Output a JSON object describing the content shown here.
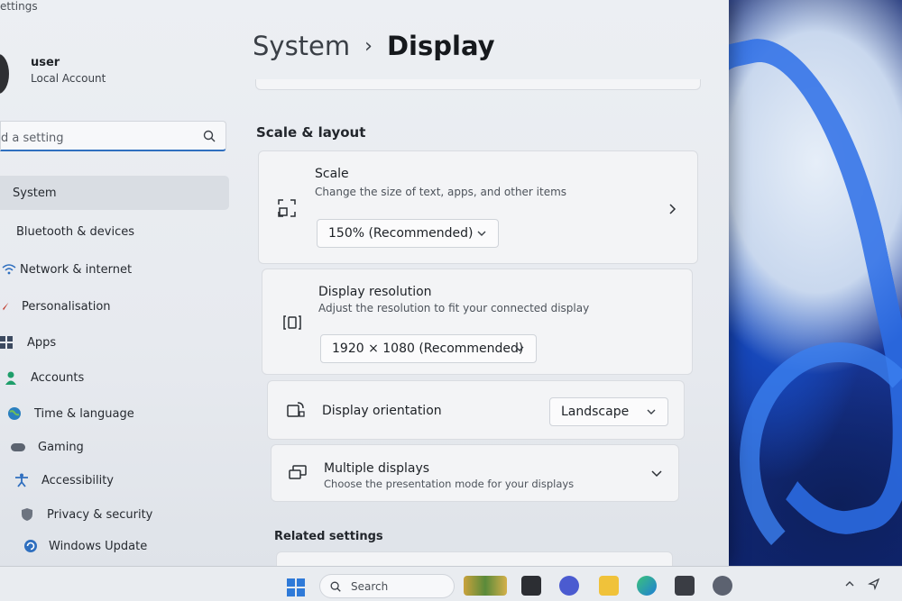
{
  "app": {
    "title": "ettings"
  },
  "profile": {
    "name": "user",
    "type": "Local Account"
  },
  "search": {
    "placeholder": "d a setting"
  },
  "sidebar": {
    "items": [
      {
        "label": "System",
        "icon": "monitor-icon",
        "active": true
      },
      {
        "label": "Bluetooth & devices",
        "icon": "bluetooth-icon"
      },
      {
        "label": "Network & internet",
        "icon": "wifi-icon"
      },
      {
        "label": "Personalisation",
        "icon": "brush-icon"
      },
      {
        "label": "Apps",
        "icon": "apps-icon"
      },
      {
        "label": "Accounts",
        "icon": "person-icon"
      },
      {
        "label": "Time & language",
        "icon": "globe-icon"
      },
      {
        "label": "Gaming",
        "icon": "gamepad-icon"
      },
      {
        "label": "Accessibility",
        "icon": "accessibility-icon"
      },
      {
        "label": "Privacy & security",
        "icon": "shield-icon"
      },
      {
        "label": "Windows Update",
        "icon": "update-icon"
      }
    ]
  },
  "header": {
    "parent": "System",
    "separator": "›",
    "current": "Display"
  },
  "scale_layout": {
    "title": "Scale & layout",
    "scale": {
      "title": "Scale",
      "description": "Change the size of text, apps, and other items",
      "value": "150% (Recommended)"
    },
    "resolution": {
      "title": "Display resolution",
      "description": "Adjust the resolution to fit your connected display",
      "value": "1920 × 1080 (Recommended)"
    },
    "orientation": {
      "title": "Display orientation",
      "value": "Landscape"
    },
    "multiple": {
      "title": "Multiple displays",
      "description": "Choose the presentation mode for your displays"
    }
  },
  "related": {
    "title": "Related settings"
  },
  "taskbar": {
    "search_label": "Search",
    "apps": [
      "widgets-icon",
      "file-explorer-icon",
      "chat-icon",
      "folder-icon",
      "edge-icon",
      "store-icon",
      "settings-icon"
    ]
  },
  "colors": {
    "accent": "#2f6fbf",
    "window": "#eceff3",
    "card": "#f3f4f6"
  }
}
